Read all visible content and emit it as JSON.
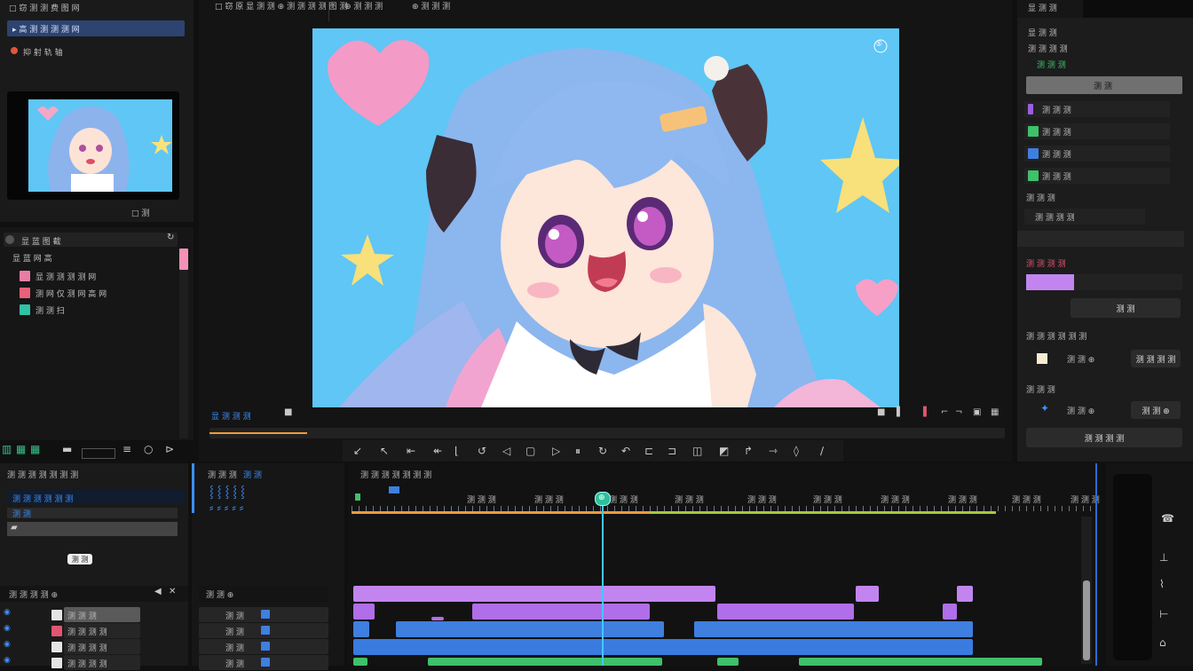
{
  "colors": {
    "accent_blue": "#3e8ef7",
    "purple_clip": "#c285f0",
    "purple_clip_dark": "#b06ee8",
    "blue_clip": "#3f7fe0",
    "green_clip": "#3fc06a",
    "playhead": "#45c6ff",
    "sky": "#5fc6f5"
  },
  "top_left": {
    "title": "□ 窃 测 测 费 图 网",
    "project_item": "▸ 高 测 测 测 测 网",
    "settings_item": "抑 射 轨 轴",
    "thumb_caption": "□ 测",
    "icon_left_tabs": [
      "circle-record-icon"
    ]
  },
  "assets_panel": {
    "header": "显 蓝 图 截",
    "subheader": "显 蓝 网 高",
    "items": [
      {
        "label": "显 测 测 测 测 网",
        "color": "#e97da6"
      },
      {
        "label": "测 网 仅 测 网 高 网",
        "color": "#e9607a"
      },
      {
        "label": "测 测 扫",
        "color": "#2fc2a4"
      }
    ]
  },
  "viewer": {
    "header_left": "□ 窃 原 显 测 测 ⊕ 测 测 测 测 图 测",
    "header_mid": "⊕ 测 测 测",
    "header_right": "⊕ 测 测 测",
    "timecode_left": "显 测 测 测",
    "zoom_badge": "⑤",
    "scene_desc": "anime-girl-blue-hair"
  },
  "right_panel": {
    "tab_label": "显 测 测",
    "row_labels": [
      "显 测 测",
      "测 测 测 测",
      "测 测 测",
      "测 测 测",
      "测 测 测 测"
    ],
    "row_values": [
      "测 测",
      "测 测 测",
      "测 测 测",
      "测 测 测",
      "测 测 测"
    ],
    "blend_label": "测 测 测 测",
    "button_apply": "测 测",
    "section_color": "测 测 测 测 测 测",
    "color_value": "测 测 ⊕",
    "button_reset": "测 测 测 测",
    "section_anim": "测 测 测",
    "anim_value": "测 测 ⊕",
    "button_keyframe": "测 测 ⊕",
    "button_wide": "测 测 测 测"
  },
  "timeline_left": {
    "header": "测 测 测 测 测 测 测",
    "search_placeholder": "测 测 测 测 测 测",
    "bin_label": "测 测",
    "button_import": "测 测",
    "track_header": "测 测 测 测 ⊕",
    "tracks": [
      {
        "name": "测 测 测",
        "color": "#e5e5e5"
      },
      {
        "name": "测 测 测 测",
        "color": "#e05670"
      },
      {
        "name": "测 测 测 测",
        "color": "#e5e5e5"
      },
      {
        "name": "测 测 测 测",
        "color": "#e5e5e5"
      }
    ]
  },
  "timeline_mid": {
    "header": "测 测 测",
    "header_b": "测 测",
    "track_header": "测 测 ⊕",
    "track_rows": [
      "测 测",
      "测 测",
      "测 测",
      "测 测"
    ]
  },
  "timeline": {
    "header": "测 测 测 测 测 测 测",
    "ruler_labels": [
      "测 测 测",
      "测 测 测",
      "测 测 测",
      "测 测 测",
      "测 测 测",
      "测 测 测",
      "测 测 测",
      "测 测 测",
      "测 测 测",
      "测 测 测"
    ],
    "playhead_label": "⊕"
  }
}
